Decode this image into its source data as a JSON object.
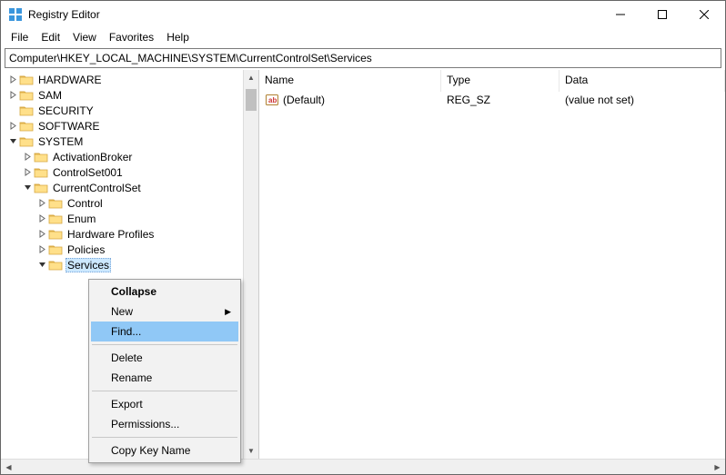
{
  "titlebar": {
    "title": "Registry Editor"
  },
  "menubar": {
    "file": "File",
    "edit": "Edit",
    "view": "View",
    "favorites": "Favorites",
    "help": "Help"
  },
  "addressbar": {
    "path": "Computer\\HKEY_LOCAL_MACHINE\\SYSTEM\\CurrentControlSet\\Services"
  },
  "tree": {
    "items": [
      {
        "level": 0,
        "expander": "right",
        "label": "HARDWARE"
      },
      {
        "level": 0,
        "expander": "right",
        "label": "SAM"
      },
      {
        "level": 0,
        "expander": "none",
        "label": "SECURITY"
      },
      {
        "level": 0,
        "expander": "right",
        "label": "SOFTWARE"
      },
      {
        "level": 0,
        "expander": "down",
        "label": "SYSTEM"
      },
      {
        "level": 1,
        "expander": "right",
        "label": "ActivationBroker"
      },
      {
        "level": 1,
        "expander": "right",
        "label": "ControlSet001"
      },
      {
        "level": 1,
        "expander": "down",
        "label": "CurrentControlSet"
      },
      {
        "level": 2,
        "expander": "right",
        "label": "Control"
      },
      {
        "level": 2,
        "expander": "right",
        "label": "Enum"
      },
      {
        "level": 2,
        "expander": "right",
        "label": "Hardware Profiles"
      },
      {
        "level": 2,
        "expander": "right",
        "label": "Policies"
      },
      {
        "level": 2,
        "expander": "down",
        "label": "Services",
        "selected": true
      }
    ]
  },
  "list": {
    "headers": {
      "name": "Name",
      "type": "Type",
      "data": "Data"
    },
    "rows": [
      {
        "name": "(Default)",
        "type": "REG_SZ",
        "data": "(value not set)"
      }
    ]
  },
  "contextmenu": {
    "items": {
      "collapse": "Collapse",
      "new": "New",
      "find": "Find...",
      "delete": "Delete",
      "rename": "Rename",
      "export": "Export",
      "permissions": "Permissions...",
      "copykeyname": "Copy Key Name"
    }
  }
}
